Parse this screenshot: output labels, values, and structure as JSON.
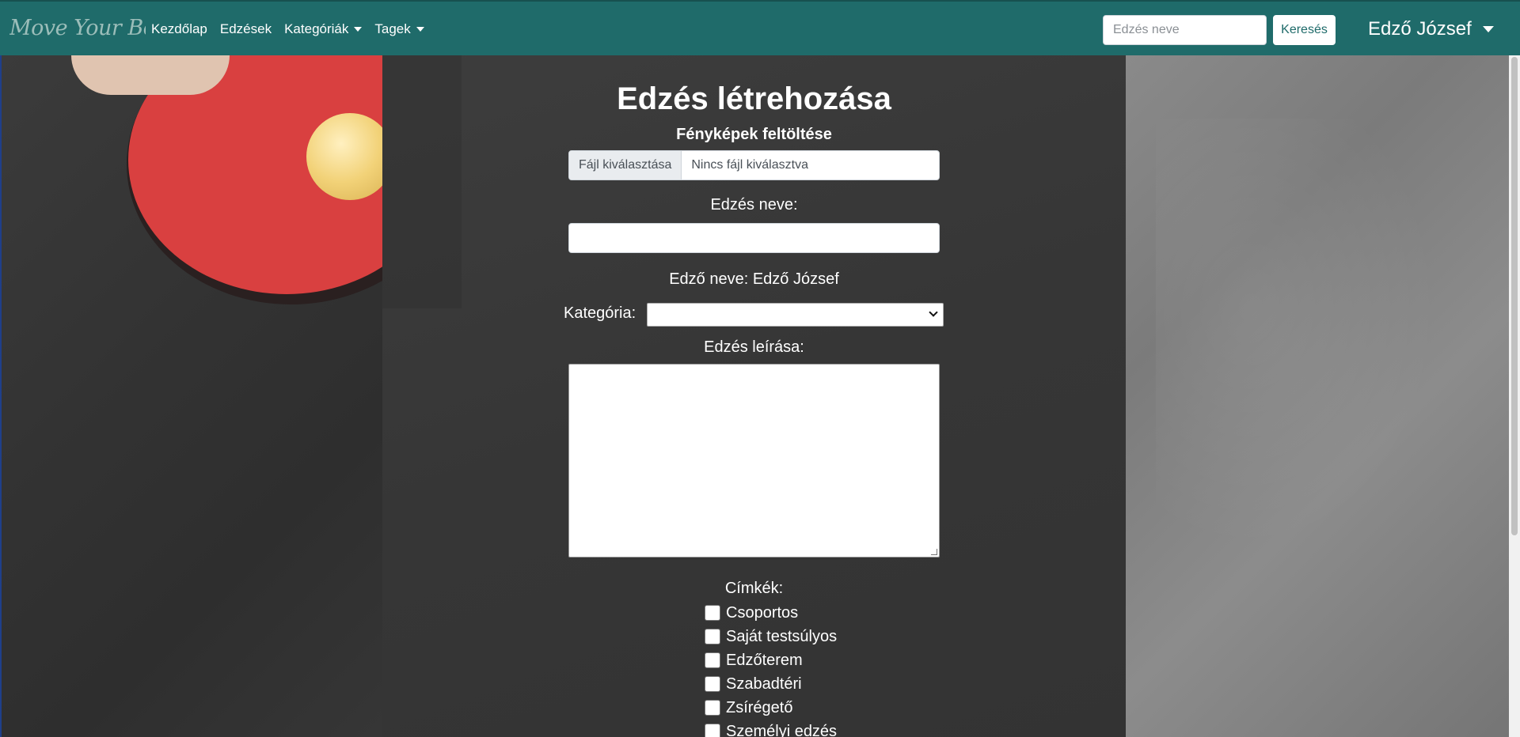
{
  "navbar": {
    "brand": "Move Your Body",
    "links": [
      {
        "label": "Kezdőlap",
        "dropdown": false
      },
      {
        "label": "Edzések",
        "dropdown": false
      },
      {
        "label": "Kategóriák",
        "dropdown": true
      },
      {
        "label": "Tagek",
        "dropdown": true
      }
    ],
    "search_placeholder": "Edzés neve",
    "search_button": "Keresés",
    "user_name": "Edző József"
  },
  "form": {
    "title": "Edzés létrehozása",
    "photo_label": "Fényképek feltöltése",
    "file_button": "Fájl kiválasztása",
    "file_status": "Nincs fájl kiválasztva",
    "name_label": "Edzés neve:",
    "name_value": "",
    "trainer_line": "Edző neve: Edző József",
    "category_label": "Kategória:",
    "category_selected": "",
    "description_label": "Edzés leírása:",
    "description_value": "",
    "tags_label": "Címkék:",
    "tags": [
      "Csoportos",
      "Saját testsúlyos",
      "Edzőterem",
      "Szabadtéri",
      "Zsírégető",
      "Személyi edzés"
    ]
  },
  "colors": {
    "navbar": "#1f6b6a",
    "paddle": "#d94040"
  }
}
